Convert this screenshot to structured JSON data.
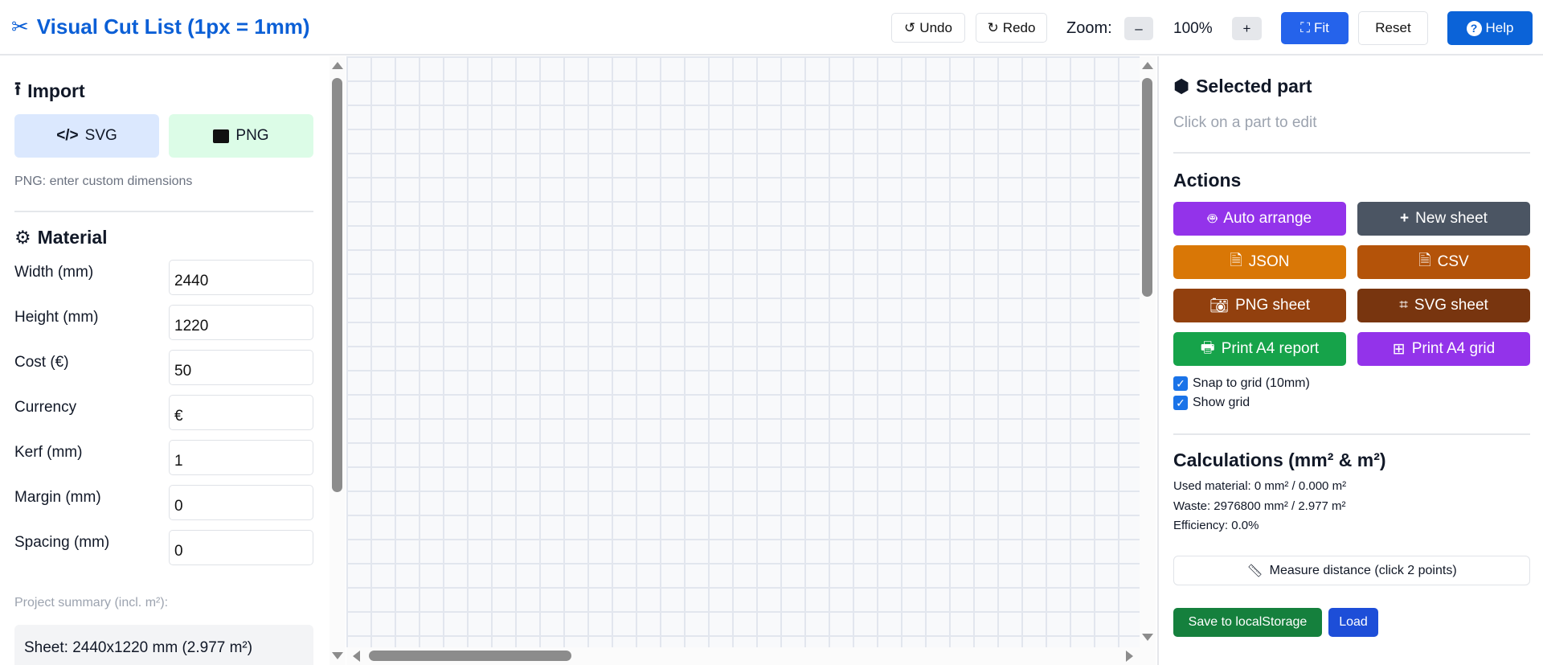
{
  "header": {
    "title": "Visual Cut List (1px = 1mm)",
    "undo": "Undo",
    "redo": "Redo",
    "zoom_label": "Zoom:",
    "zoom_minus": "–",
    "zoom_value": "100%",
    "zoom_plus": "+",
    "fit": "Fit",
    "reset": "Reset",
    "help": "Help"
  },
  "import": {
    "heading": "Import",
    "svg": "SVG",
    "png": "PNG",
    "note": "PNG: enter custom dimensions"
  },
  "material": {
    "heading": "Material",
    "fields": [
      {
        "label": "Width (mm)",
        "value": "2440"
      },
      {
        "label": "Height (mm)",
        "value": "1220"
      },
      {
        "label": "Cost (€)",
        "value": "50"
      },
      {
        "label": "Currency",
        "value": "€"
      },
      {
        "label": "Kerf (mm)",
        "value": "1"
      },
      {
        "label": "Margin (mm)",
        "value": "0"
      },
      {
        "label": "Spacing (mm)",
        "value": "0"
      }
    ]
  },
  "summary": {
    "label": "Project summary (incl. m²):",
    "sheet": "Sheet: 2440x1220 mm (2.977 m²)"
  },
  "selected": {
    "heading": "Selected part",
    "hint": "Click on a part to edit"
  },
  "actions": {
    "heading": "Actions",
    "buttons": [
      {
        "label": "Auto arrange",
        "color": "#9333ea"
      },
      {
        "label": "New sheet",
        "color": "#4b5563"
      },
      {
        "label": "JSON",
        "color": "#d97706"
      },
      {
        "label": "CSV",
        "color": "#b45309"
      },
      {
        "label": "PNG sheet",
        "color": "#92400e"
      },
      {
        "label": "SVG sheet",
        "color": "#78350f"
      },
      {
        "label": "Print A4 report",
        "color": "#16a34a"
      },
      {
        "label": "Print A4 grid",
        "color": "#9333ea"
      }
    ],
    "snap": "Snap to grid (10mm)",
    "show_grid": "Show grid"
  },
  "calc": {
    "heading": "Calculations (mm² & m²)",
    "used": "Used material: 0 mm² / 0.000 m²",
    "waste": "Waste: 2976800 mm² / 2.977 m²",
    "efficiency": "Efficiency: 0.0%"
  },
  "measure": "Measure distance (click 2 points)",
  "save": "Save to localStorage",
  "load": "Load"
}
